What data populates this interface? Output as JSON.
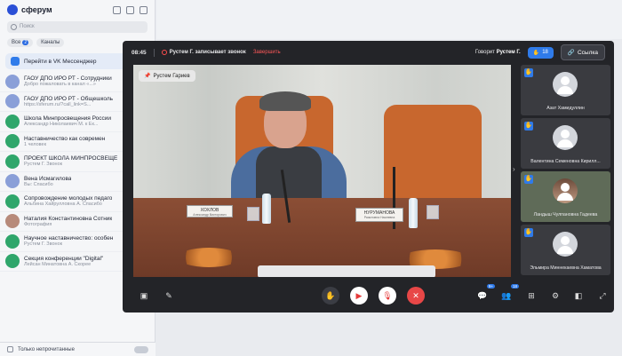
{
  "sidebar": {
    "app_name": "сферум",
    "search_placeholder": "Поиск",
    "tabs": [
      {
        "label": "Все",
        "count": "2"
      },
      {
        "label": "Каналы"
      }
    ],
    "vk_banner": "Перейти в VK Мессенджер",
    "chats": [
      {
        "name": "ГАОУ ДПО ИРО РТ - Сотрудники",
        "preview": "Добро пожаловать в канал «...»",
        "avatar": "blue"
      },
      {
        "name": "ГАОУ ДПО ИРО РТ - Общешколь",
        "preview": "https://sferum.ru/?call_link=S...",
        "avatar": "blue"
      },
      {
        "name": "Школа Минпросвещения России",
        "preview": "Александр Николаевич М. к Ек...",
        "avatar": "green"
      },
      {
        "name": "Наставничество как современ",
        "preview": "1 человек",
        "avatar": "green"
      },
      {
        "name": "ПРОЕКТ ШКОЛА МИНПРОСВЕЩЕ",
        "preview": "Рустем Г. Звонок",
        "avatar": "green"
      },
      {
        "name": "Вена Исмагилова",
        "preview": "Вы: Спасибо",
        "avatar": "blue"
      },
      {
        "name": "Сопровождение молодых педаго",
        "preview": "Альбина Хайрулловна А. Спасибо",
        "avatar": "green"
      },
      {
        "name": "Наталия Константиновна Сотник",
        "preview": "Фотография",
        "avatar": "photo"
      },
      {
        "name": "Научное наставничество: особен",
        "preview": "Рустем Г. Звонок",
        "avatar": "green"
      },
      {
        "name": "Секция конференции \"Digital\"",
        "preview": "Лейсан Минатовна А. Скорее",
        "avatar": "green"
      }
    ],
    "footer_label": "Только непрочитанные"
  },
  "call": {
    "time": "08:45",
    "recording_text": "Рустем Г. записывает звонок",
    "finish_label": "Завершить",
    "speaking_prefix": "Говорит",
    "speaking_name": "Рустем Г.",
    "participants_count": "18",
    "link_label": "Ссылка",
    "pinned_name": "Рустем Гариев",
    "nameplates": [
      {
        "name": "ХОХЛОВ",
        "sub": "Александр Викторович"
      },
      {
        "name": "НУРУМАНОВА",
        "sub": "Разиловна Наилевна"
      }
    ],
    "tiles": [
      {
        "name": "Азат Хамидуллин",
        "photo": false
      },
      {
        "name": "Валентина Семеновна Кирилл...",
        "photo": false
      },
      {
        "name": "Ландыш Чулпановна Гадеева",
        "photo": true
      },
      {
        "name": "Эльмира Миннекаевна Хаматова",
        "photo": false
      }
    ],
    "controls": {
      "chat_badge": "9+",
      "participants_badge": "18"
    }
  },
  "colors": {
    "accent": "#2f7bea",
    "end_call": "#e84747",
    "call_bg": "#232428"
  }
}
